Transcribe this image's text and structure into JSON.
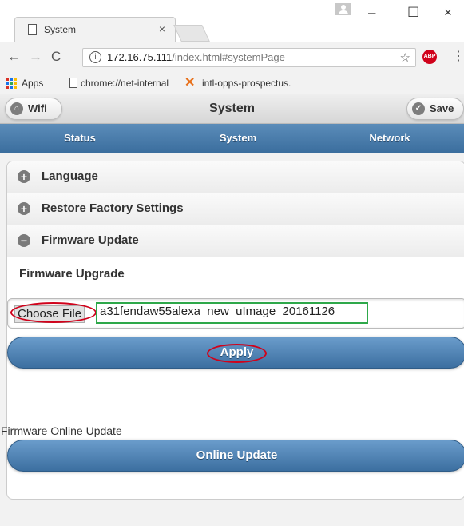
{
  "browser": {
    "tab_title": "System",
    "tab_close": "×",
    "window_controls": {
      "minimize": "–",
      "maximize": "☐",
      "close": "×"
    },
    "url_host": "172.16.75.111",
    "url_path": "/index.html#systemPage",
    "bookmarks": [
      {
        "label": "Apps",
        "icon": "apps-grid-icon"
      },
      {
        "label": "chrome://net-internal",
        "icon": "page-icon"
      },
      {
        "label": "intl-opps-prospectus.",
        "icon": "x-mark-icon"
      }
    ],
    "extension_label": "ABP"
  },
  "app": {
    "title": "System",
    "left_button": "Wifi",
    "right_button": "Save",
    "nav_tabs": [
      "Status",
      "System",
      "Network"
    ],
    "sections": [
      {
        "label": "Language",
        "state": "collapsed"
      },
      {
        "label": "Restore Factory Settings",
        "state": "collapsed"
      },
      {
        "label": "Firmware Update",
        "state": "expanded"
      }
    ],
    "firmware": {
      "subheading": "Firmware Upgrade",
      "choose_file_label": "Choose File",
      "selected_file": "a31fendaw55alexa_new_uImage_20161126",
      "apply_label": "Apply",
      "online_label": "Firmware Online Update",
      "online_button": "Online Update"
    }
  },
  "colors": {
    "accent_blue": "#3b6e9e",
    "annotation_red": "#d0021b",
    "annotation_green": "#2ea84a"
  }
}
